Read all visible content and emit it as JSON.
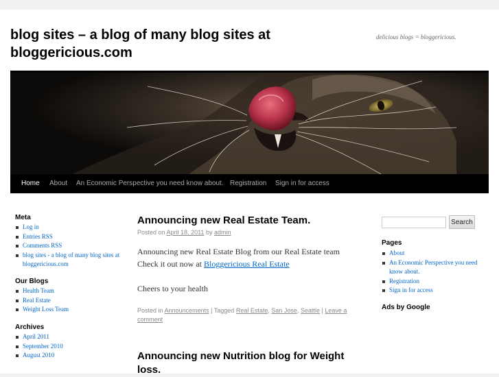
{
  "header": {
    "site_title": "blog sites – a blog of many blog sites at bloggericious.com",
    "site_description": "delicious blogs = bloggericious."
  },
  "nav": {
    "items": [
      {
        "label": "Home"
      },
      {
        "label": "About"
      },
      {
        "label": "An Economic Perspective you need know about."
      },
      {
        "label": "Registration"
      },
      {
        "label": "Sign in for access"
      }
    ]
  },
  "left_sidebar": {
    "meta": {
      "heading": "Meta",
      "links": [
        "Log in",
        "Entries RSS",
        "Comments RSS",
        "blog sites - a blog of many blog sites at bloggericious.com"
      ]
    },
    "our_blogs": {
      "heading": "Our Blogs",
      "links": [
        "Health Team",
        "Real Estate",
        "Weight Loss Team"
      ]
    },
    "archives": {
      "heading": "Archives",
      "links": [
        "April 2011",
        "September 2010",
        "August 2010"
      ]
    }
  },
  "posts": [
    {
      "title": "Announcing new Real Estate Team.",
      "posted_on_prefix": "Posted on",
      "date": "April 18, 2011",
      "by_word": "by",
      "author": "admin",
      "body_line1": "Announcing new Real Estate Blog from our Real Estate team",
      "body_line2_text": "Check it out now at",
      "body_link": "Bloggericious Real Estate",
      "body_para2": "Cheers to your health",
      "footer": {
        "posted_in_prefix": "Posted in",
        "category": "Announcements",
        "tagged_prefix": "| Tagged",
        "tags": [
          "Real Estate",
          "San Jose",
          "Seattle"
        ],
        "comment_link": "Leave a comment"
      }
    },
    {
      "title": "Announcing new Nutrition blog for Weight loss."
    }
  ],
  "right_sidebar": {
    "search": {
      "placeholder": "",
      "button_label": "Search"
    },
    "pages": {
      "heading": "Pages",
      "links": [
        "About",
        "An Economic Perspective you need know about.",
        "Registration",
        "Sign in for access"
      ]
    },
    "ads_heading": "Ads by Google"
  },
  "icons": [
    "cat-header-image"
  ],
  "colors": {
    "link": "#0066cc",
    "nav_bg": "#000000",
    "page_bg": "#f1f1f1"
  }
}
